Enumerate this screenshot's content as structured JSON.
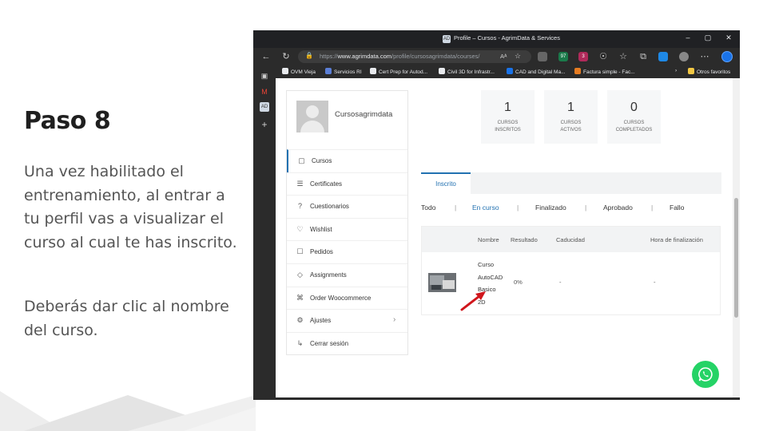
{
  "slide": {
    "title": "Paso 8",
    "paragraph1": "Una vez habilitado el entrenamiento, al entrar a tu perfil vas a visualizar el curso al cual te has inscrito.",
    "paragraph2": "Deberás dar clic al nombre del curso."
  },
  "browser": {
    "window_title": "Profile – Cursos - AgrimData & Services",
    "url_prefix": "https://",
    "url_domain": "www.agrimdata.com",
    "url_path": "/profile/cursosagrimdata/courses/",
    "read_aloud": "Aᴬ",
    "bookmarks": [
      {
        "label": "OVM Vieja",
        "color": "#e8eaed"
      },
      {
        "label": "Servicios RI",
        "color": "#5b7fd6"
      },
      {
        "label": "Cert Prep for Autod...",
        "color": "#e8eaed"
      },
      {
        "label": "Civil 3D for Infrastr...",
        "color": "#e8eaed"
      },
      {
        "label": "CAD and Digital Ma...",
        "color": "#1a73e8"
      },
      {
        "label": "Factura simple - Fac...",
        "color": "#e67c22"
      }
    ],
    "other_favorites": "Otros favoritos",
    "ext_badges": [
      "97",
      "3"
    ]
  },
  "profile": {
    "username": "Cursosagrimdata",
    "menu": [
      {
        "label": "Cursos",
        "icon": "▢"
      },
      {
        "label": "Certificates",
        "icon": "☰"
      },
      {
        "label": "Cuestionarios",
        "icon": "?"
      },
      {
        "label": "Wishlist",
        "icon": "♡"
      },
      {
        "label": "Pedidos",
        "icon": "☐"
      },
      {
        "label": "Assignments",
        "icon": "◇"
      },
      {
        "label": "Order Woocommerce",
        "icon": "⌘"
      },
      {
        "label": "Ajustes",
        "icon": "⚙"
      },
      {
        "label": "Cerrar sesión",
        "icon": "↳"
      }
    ]
  },
  "stats": [
    {
      "value": "1",
      "label_line1": "CURSOS",
      "label_line2": "INSCRITOS"
    },
    {
      "value": "1",
      "label_line1": "CURSOS",
      "label_line2": "ACTIVOS"
    },
    {
      "value": "0",
      "label_line1": "CURSOS",
      "label_line2": "COMPLETADOS"
    }
  ],
  "tabs": {
    "active": "Inscrito"
  },
  "filters": [
    "Todo",
    "En curso",
    "Finalizado",
    "Aprobado",
    "Fallo"
  ],
  "table": {
    "headers": [
      "Nombre",
      "Resultado",
      "Caducidad",
      "Hora de finalización"
    ],
    "row": {
      "name_lines": [
        "Curso",
        "AutoCAD",
        "Basico",
        "2D"
      ],
      "result": "0%",
      "expiry": "-",
      "finish_time": "-"
    }
  }
}
